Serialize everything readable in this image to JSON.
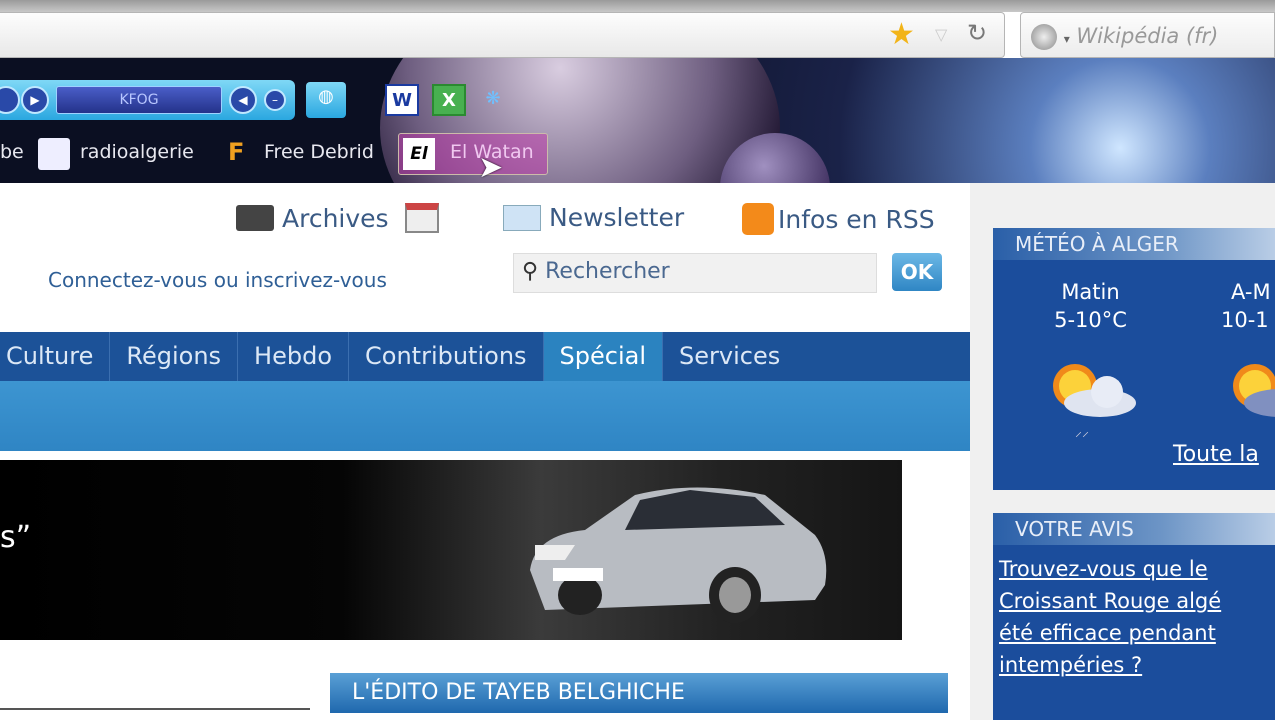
{
  "browser": {
    "search_engine": "Wikipédia (fr)",
    "player_station": "KFOG",
    "bookmarks": [
      "be",
      "radioalgerie",
      "Free Debrid",
      "El Watan"
    ],
    "toolbar_icons": [
      "word-icon",
      "excel-icon",
      "messenger-icon"
    ]
  },
  "header": {
    "archives": "Archives",
    "newsletter": "Newsletter",
    "rss": "Infos en RSS",
    "connect": "Connectez-vous ou inscrivez-vous",
    "search_placeholder": "Rechercher",
    "ok": "OK"
  },
  "nav": {
    "items": [
      "Culture",
      "Régions",
      "Hebdo",
      "Contributions",
      "Spécial",
      "Services"
    ],
    "active": "Spécial"
  },
  "banner": {
    "quote": "s”"
  },
  "edito": {
    "title": "L'ÉDITO DE TAYEB BELGHICHE"
  },
  "sidebar": {
    "meteo": {
      "title": "MÉTÉO À ALGER",
      "periods": [
        {
          "label": "Matin",
          "temp": "5-10°C"
        },
        {
          "label": "A-M",
          "temp": "10-1"
        }
      ],
      "link": "Toute la"
    },
    "avis": {
      "title": "VOTRE AVIS",
      "question_lines": [
        "Trouvez-vous que le",
        "Croissant Rouge algé",
        "été efficace pendant",
        "intempéries ?"
      ]
    }
  }
}
